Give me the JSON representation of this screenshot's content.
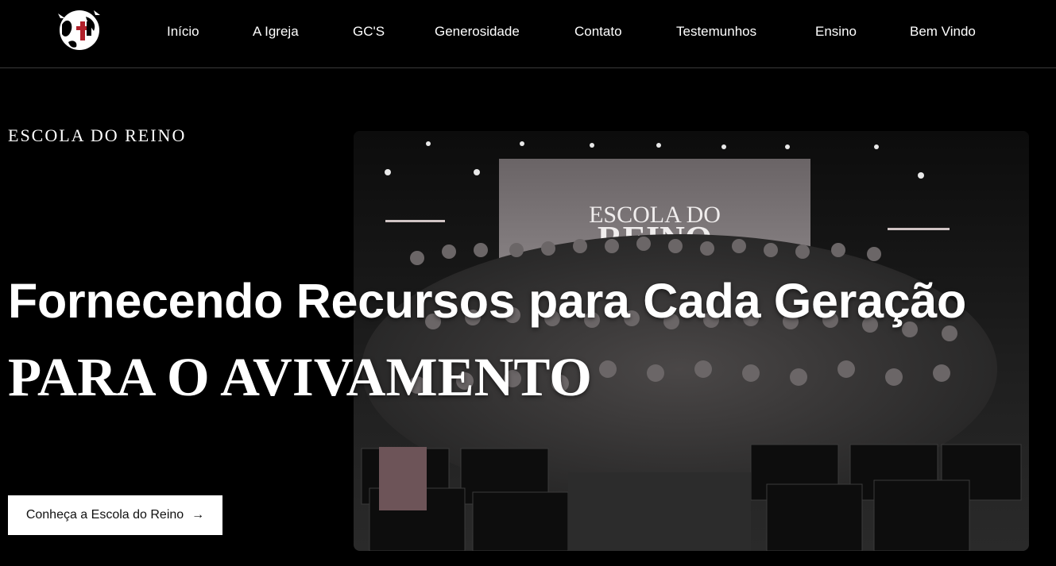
{
  "nav": {
    "items": [
      {
        "label": "Início"
      },
      {
        "label": "A Igreja"
      },
      {
        "label": "GC'S"
      },
      {
        "label": "Generosidade"
      },
      {
        "label": "Contato"
      },
      {
        "label": "Testemunhos"
      },
      {
        "label": "Ensino"
      },
      {
        "label": "Bem Vindo"
      }
    ]
  },
  "hero": {
    "eyebrow": "ESCOLA DO REINO",
    "headline": "Fornecendo Recursos para Cada Geração",
    "subheadline": "PARA O AVIVAMENTO",
    "cta_label": "Conheça a Escola do Reino",
    "cta_arrow": "→"
  },
  "photo": {
    "screen_line1": "ESCOLA DO",
    "screen_line2": "REINO"
  },
  "colors": {
    "background": "#000000",
    "text": "#ffffff",
    "logo_accent": "#b0202a",
    "button_bg": "#ffffff",
    "button_text": "#111111"
  }
}
